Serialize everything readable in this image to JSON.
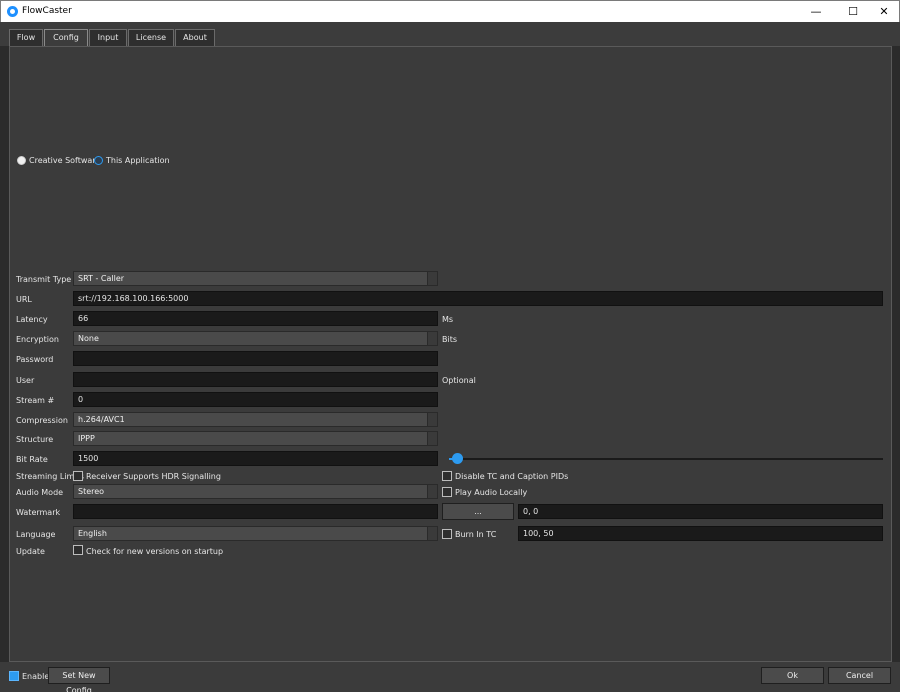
{
  "window": {
    "title": "FlowCaster",
    "controls": {
      "minimize": "—",
      "maximize": "☐",
      "close": "✕"
    }
  },
  "tabs": [
    {
      "label": "Flow"
    },
    {
      "label": "Config",
      "active": true
    },
    {
      "label": "Input"
    },
    {
      "label": "License"
    },
    {
      "label": "About"
    }
  ],
  "mode": {
    "options": [
      {
        "label": "Creative Software",
        "selected": false
      },
      {
        "label": "This Application",
        "selected": true
      }
    ]
  },
  "form": {
    "transmit_type": {
      "label": "Transmit Type",
      "value": "SRT - Caller"
    },
    "url": {
      "label": "URL",
      "value": "srt://192.168.100.166:5000"
    },
    "latency": {
      "label": "Latency",
      "value": "66",
      "unit": "Ms"
    },
    "encryption": {
      "label": "Encryption",
      "value": "None",
      "unit": "Bits"
    },
    "password": {
      "label": "Password",
      "value": ""
    },
    "user": {
      "label": "User",
      "value": "",
      "hint": "Optional"
    },
    "stream": {
      "label": "Stream #",
      "value": "0"
    },
    "compression": {
      "label": "Compression",
      "value": "h.264/AVC1"
    },
    "structure": {
      "label": "Structure",
      "value": "IPPP"
    },
    "bit_rate": {
      "label": "Bit Rate",
      "value": "1500",
      "slider_fraction": 0.01
    },
    "streaming_limits": {
      "label": "Streaming Limits",
      "hdr_label": "Receiver Supports HDR Signalling",
      "hdr_checked": false,
      "tc_label": "Disable TC and Caption PIDs",
      "tc_checked": false
    },
    "audio_mode": {
      "label": "Audio Mode",
      "value": "Stereo",
      "play_label": "Play Audio Locally",
      "play_checked": false
    },
    "watermark": {
      "label": "Watermark",
      "value": "",
      "browse_label": "...",
      "position": "0, 0"
    },
    "language": {
      "label": "Language",
      "value": "English",
      "burn_label": "Burn In TC",
      "burn_checked": false,
      "burn_position": "100, 50"
    },
    "update": {
      "label": "Update",
      "check_label": "Check for new versions on startup",
      "checked": false
    }
  },
  "footer": {
    "enable_label": "Enable",
    "enable_checked": true,
    "set_config_label": "Set New Config",
    "ok_label": "Ok",
    "cancel_label": "Cancel"
  },
  "colors": {
    "accent": "#2d9bf0",
    "background": "#3b3b3b",
    "field": "#1a1a1a"
  }
}
